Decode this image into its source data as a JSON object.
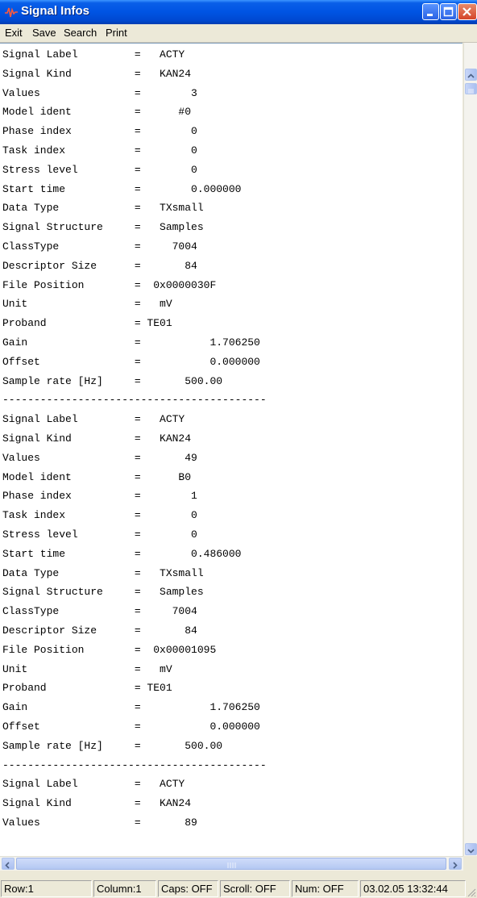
{
  "window": {
    "title": "Signal Infos",
    "app_icon": "signal-waveform-icon",
    "controls": [
      "minimize-icon",
      "maximize-icon",
      "close-icon"
    ]
  },
  "menu": {
    "items": [
      {
        "label": "Exit"
      },
      {
        "label": "Save"
      },
      {
        "label": "Search"
      },
      {
        "label": "Print"
      }
    ]
  },
  "content": {
    "lines": [
      "Signal Label         =   ACTY",
      "Signal Kind          =   KAN24",
      "Values               =        3",
      "Model ident          =      #0",
      "Phase index          =        0",
      "Task index           =        0",
      "Stress level         =        0",
      "Start time           =        0.000000",
      "Data Type            =   TXsmall",
      "Signal Structure     =   Samples",
      "ClassType            =     7004",
      "Descriptor Size      =       84",
      "File Position        =  0x0000030F",
      "Unit                 =   mV",
      "Proband              = TE01",
      "Gain                 =           1.706250",
      "Offset               =           0.000000",
      "Sample rate [Hz]     =       500.00",
      "------------------------------------------",
      "Signal Label         =   ACTY",
      "Signal Kind          =   KAN24",
      "Values               =       49",
      "Model ident          =      B0",
      "Phase index          =        1",
      "Task index           =        0",
      "Stress level         =        0",
      "Start time           =        0.486000",
      "Data Type            =   TXsmall",
      "Signal Structure     =   Samples",
      "ClassType            =     7004",
      "Descriptor Size      =       84",
      "File Position        =  0x00001095",
      "Unit                 =   mV",
      "Proband              = TE01",
      "Gain                 =           1.706250",
      "Offset               =           0.000000",
      "Sample rate [Hz]     =       500.00",
      "------------------------------------------",
      "Signal Label         =   ACTY",
      "Signal Kind          =   KAN24",
      "Values               =       89"
    ]
  },
  "status": {
    "row": "Row:1",
    "column": "Column:1",
    "caps": "Caps: OFF",
    "scroll": "Scroll: OFF",
    "num": "Num: OFF",
    "datetime": "03.02.05 13:32:44"
  },
  "colors": {
    "titlebar": "#0054e3",
    "menu_bg": "#ece9d8",
    "content_bg": "#ffffff",
    "scrollbar": "#a9bff0"
  }
}
